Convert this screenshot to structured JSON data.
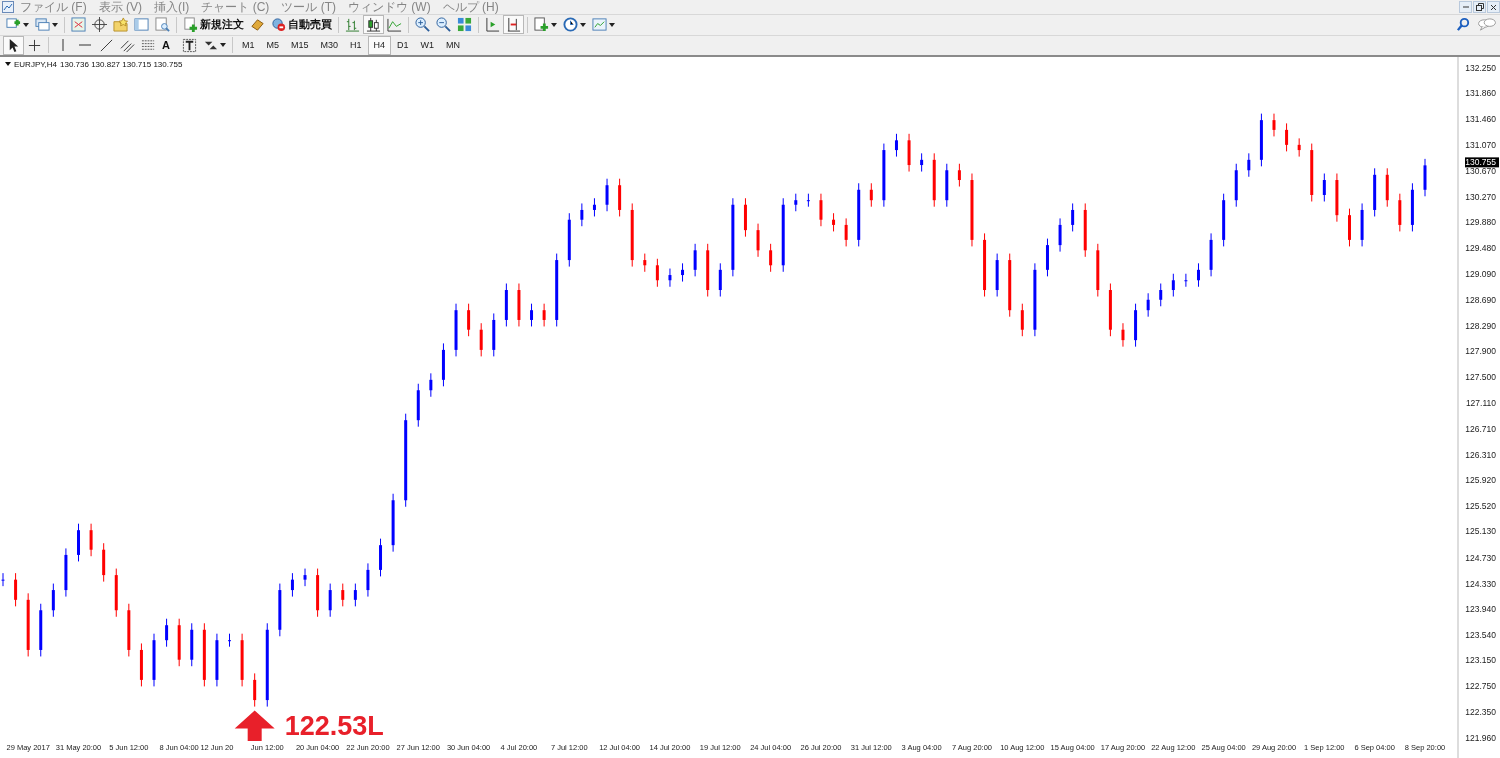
{
  "menu": [
    {
      "label": "ファイル (F)"
    },
    {
      "label": "表示 (V)"
    },
    {
      "label": "挿入(I)"
    },
    {
      "label": "チャート (C)"
    },
    {
      "label": "ツール (T)"
    },
    {
      "label": "ウィンドウ (W)"
    },
    {
      "label": "ヘルプ (H)"
    }
  ],
  "toolbar": {
    "order_button": "新規注文",
    "auto_trading_button": "自動売買",
    "text_tool": "A"
  },
  "timeframes": [
    {
      "label": "M1",
      "selected": false
    },
    {
      "label": "M5",
      "selected": false
    },
    {
      "label": "M15",
      "selected": false
    },
    {
      "label": "M30",
      "selected": false
    },
    {
      "label": "H1",
      "selected": false
    },
    {
      "label": "H4",
      "selected": true
    },
    {
      "label": "D1",
      "selected": false
    },
    {
      "label": "W1",
      "selected": false
    },
    {
      "label": "MN",
      "selected": false
    }
  ],
  "chart": {
    "symbol": "EURJPY,H4",
    "quote": "130.736 130.827 130.715 130.755",
    "price_tag": "130.755",
    "chart_data": {
      "type": "candlestick",
      "ylim": [
        121.65,
        132.42
      ],
      "categories": [
        null,
        null,
        "29 May 2017",
        null,
        null,
        null,
        "31 May 20:00",
        null,
        null,
        null,
        "5 Jun 12:00",
        null,
        null,
        null,
        "8 Jun 04:00",
        null,
        null,
        "12 Jun 20",
        null,
        null,
        null,
        "Jun 12:00",
        null,
        null,
        null,
        "20 Jun 04:00",
        null,
        null,
        null,
        "22 Jun 20:00",
        null,
        null,
        null,
        "27 Jun 12:00",
        null,
        null,
        null,
        "30 Jun 04:00",
        null,
        null,
        null,
        "4 Jul 20:00",
        null,
        null,
        null,
        "7 Jul 12:00",
        null,
        null,
        null,
        "12 Jul 04:00",
        null,
        null,
        null,
        "14 Jul 20:00",
        null,
        null,
        null,
        "19 Jul 12:00",
        null,
        null,
        null,
        "24 Jul 04:00",
        null,
        null,
        null,
        "26 Jul 20:00",
        null,
        null,
        null,
        "31 Jul 12:00",
        null,
        null,
        null,
        "3 Aug 04:00",
        null,
        null,
        null,
        "7 Aug 20:00",
        null,
        null,
        null,
        "10 Aug 12:00",
        null,
        null,
        null,
        "15 Aug 04:00",
        null,
        null,
        null,
        "17 Aug 20:00",
        null,
        null,
        null,
        "22 Aug 12:00",
        null,
        null,
        null,
        "25 Aug 04:00",
        null,
        null,
        null,
        "29 Aug 20:00",
        null,
        null,
        null,
        "1 Sep 12:00",
        null,
        null,
        null,
        "6 Sep 04:00",
        null,
        null,
        null,
        "8 Sep 20:00"
      ],
      "ohlc": [
        [
          124.39,
          124.49,
          124.29,
          124.39
        ],
        [
          124.39,
          124.49,
          123.98,
          124.08
        ],
        [
          124.08,
          124.18,
          123.21,
          123.31
        ],
        [
          123.31,
          124.02,
          123.21,
          123.92
        ],
        [
          123.92,
          124.33,
          123.82,
          124.23
        ],
        [
          124.23,
          124.87,
          124.13,
          124.77
        ],
        [
          124.77,
          125.25,
          124.67,
          125.15
        ],
        [
          125.15,
          125.25,
          124.75,
          124.85
        ],
        [
          124.85,
          124.95,
          124.36,
          124.46
        ],
        [
          124.46,
          124.56,
          123.82,
          123.92
        ],
        [
          123.92,
          124.02,
          123.21,
          123.31
        ],
        [
          123.31,
          123.41,
          122.75,
          122.85
        ],
        [
          122.85,
          123.56,
          122.75,
          123.46
        ],
        [
          123.46,
          123.79,
          123.36,
          123.69
        ],
        [
          123.69,
          123.79,
          123.06,
          123.16
        ],
        [
          123.16,
          123.72,
          123.06,
          123.62
        ],
        [
          123.62,
          123.72,
          122.75,
          122.85
        ],
        [
          122.85,
          123.56,
          122.75,
          123.46
        ],
        [
          123.46,
          123.56,
          123.36,
          123.46
        ],
        [
          123.46,
          123.56,
          122.75,
          122.85
        ],
        [
          122.85,
          122.95,
          122.44,
          122.54
        ],
        [
          122.54,
          123.72,
          122.44,
          123.62
        ],
        [
          123.62,
          124.33,
          123.52,
          124.23
        ],
        [
          124.23,
          124.49,
          124.13,
          124.39
        ],
        [
          124.39,
          124.56,
          124.29,
          124.46
        ],
        [
          124.46,
          124.56,
          123.82,
          123.92
        ],
        [
          123.92,
          124.33,
          123.82,
          124.23
        ],
        [
          124.23,
          124.33,
          123.98,
          124.08
        ],
        [
          124.08,
          124.33,
          123.98,
          124.23
        ],
        [
          124.23,
          124.64,
          124.13,
          124.54
        ],
        [
          124.54,
          125.02,
          124.44,
          124.92
        ],
        [
          124.92,
          125.71,
          124.82,
          125.61
        ],
        [
          125.61,
          126.94,
          125.51,
          126.84
        ],
        [
          126.84,
          127.4,
          126.74,
          127.3
        ],
        [
          127.3,
          127.56,
          127.2,
          127.46
        ],
        [
          127.46,
          128.02,
          127.36,
          127.92
        ],
        [
          127.92,
          128.63,
          127.82,
          128.53
        ],
        [
          128.53,
          128.63,
          128.13,
          128.23
        ],
        [
          128.23,
          128.33,
          127.82,
          127.92
        ],
        [
          127.92,
          128.48,
          127.82,
          128.38
        ],
        [
          128.38,
          128.94,
          128.28,
          128.84
        ],
        [
          128.84,
          128.94,
          128.28,
          128.38
        ],
        [
          128.38,
          128.63,
          128.28,
          128.53
        ],
        [
          128.53,
          128.63,
          128.28,
          128.38
        ],
        [
          128.38,
          129.4,
          128.28,
          129.3
        ],
        [
          129.3,
          130.02,
          129.2,
          129.92
        ],
        [
          129.92,
          130.17,
          129.82,
          130.07
        ],
        [
          130.07,
          130.25,
          129.97,
          130.15
        ],
        [
          130.15,
          130.55,
          130.05,
          130.45
        ],
        [
          130.45,
          130.55,
          129.97,
          130.07
        ],
        [
          130.07,
          130.17,
          129.2,
          129.3
        ],
        [
          129.3,
          129.4,
          129.12,
          129.22
        ],
        [
          129.22,
          129.32,
          128.89,
          128.99
        ],
        [
          128.99,
          129.17,
          128.89,
          129.07
        ],
        [
          129.07,
          129.25,
          128.97,
          129.15
        ],
        [
          129.15,
          129.55,
          129.05,
          129.45
        ],
        [
          129.45,
          129.55,
          128.74,
          128.84
        ],
        [
          128.84,
          129.25,
          128.74,
          129.15
        ],
        [
          129.15,
          130.25,
          129.05,
          130.15
        ],
        [
          130.15,
          130.25,
          129.66,
          129.76
        ],
        [
          129.76,
          129.86,
          129.35,
          129.45
        ],
        [
          129.45,
          129.55,
          129.12,
          129.22
        ],
        [
          129.22,
          130.25,
          129.12,
          130.15
        ],
        [
          130.15,
          130.32,
          130.05,
          130.22
        ],
        [
          130.22,
          130.32,
          130.12,
          130.22
        ],
        [
          130.22,
          130.32,
          129.82,
          129.92
        ],
        [
          129.92,
          130.02,
          129.74,
          129.84
        ],
        [
          129.84,
          129.94,
          129.51,
          129.61
        ],
        [
          129.61,
          130.48,
          129.51,
          130.38
        ],
        [
          130.38,
          130.48,
          130.12,
          130.22
        ],
        [
          130.22,
          131.09,
          130.12,
          130.99
        ],
        [
          130.99,
          131.24,
          130.89,
          131.14
        ],
        [
          131.14,
          131.24,
          130.66,
          130.76
        ],
        [
          130.76,
          130.94,
          130.66,
          130.84
        ],
        [
          130.84,
          130.94,
          130.12,
          130.22
        ],
        [
          130.22,
          130.78,
          130.12,
          130.68
        ],
        [
          130.68,
          130.78,
          130.43,
          130.53
        ],
        [
          130.53,
          130.63,
          129.51,
          129.61
        ],
        [
          129.61,
          129.71,
          128.74,
          128.84
        ],
        [
          128.84,
          129.4,
          128.74,
          129.3
        ],
        [
          129.3,
          129.4,
          128.43,
          128.53
        ],
        [
          128.53,
          128.63,
          128.13,
          128.23
        ],
        [
          128.23,
          129.25,
          128.13,
          129.15
        ],
        [
          129.15,
          129.63,
          129.05,
          129.53
        ],
        [
          129.53,
          129.94,
          129.43,
          129.84
        ],
        [
          129.84,
          130.17,
          129.74,
          130.07
        ],
        [
          130.07,
          130.17,
          129.35,
          129.45
        ],
        [
          129.45,
          129.55,
          128.74,
          128.84
        ],
        [
          128.84,
          128.94,
          128.13,
          128.23
        ],
        [
          128.23,
          128.33,
          127.97,
          128.07
        ],
        [
          128.07,
          128.63,
          127.97,
          128.53
        ],
        [
          128.53,
          128.79,
          128.43,
          128.69
        ],
        [
          128.69,
          128.94,
          128.59,
          128.84
        ],
        [
          128.84,
          129.09,
          128.74,
          128.99
        ],
        [
          128.99,
          129.09,
          128.89,
          128.99
        ],
        [
          128.99,
          129.25,
          128.89,
          129.15
        ],
        [
          129.15,
          129.71,
          129.05,
          129.61
        ],
        [
          129.61,
          130.32,
          129.51,
          130.22
        ],
        [
          130.22,
          130.78,
          130.12,
          130.68
        ],
        [
          130.68,
          130.94,
          130.58,
          130.84
        ],
        [
          130.84,
          131.55,
          130.74,
          131.45
        ],
        [
          131.45,
          131.55,
          131.2,
          131.3
        ],
        [
          131.3,
          131.4,
          130.97,
          131.07
        ],
        [
          131.07,
          131.17,
          130.89,
          130.99
        ],
        [
          130.99,
          131.09,
          130.2,
          130.3
        ],
        [
          130.3,
          130.63,
          130.2,
          130.53
        ],
        [
          130.53,
          130.63,
          129.89,
          129.99
        ],
        [
          129.99,
          130.09,
          129.51,
          129.61
        ],
        [
          129.61,
          130.17,
          129.51,
          130.07
        ],
        [
          130.07,
          130.71,
          129.97,
          130.61
        ],
        [
          130.61,
          130.71,
          130.12,
          130.22
        ],
        [
          130.22,
          130.32,
          129.74,
          129.84
        ],
        [
          129.84,
          130.48,
          129.74,
          130.38
        ],
        [
          130.38,
          130.855,
          130.28,
          130.755
        ]
      ],
      "yticks": [
        {
          "value": 132.25,
          "label": "132.250"
        },
        {
          "value": 131.86,
          "label": "131.860"
        },
        {
          "value": 131.46,
          "label": "131.460"
        },
        {
          "value": 131.07,
          "label": "131.070"
        },
        {
          "value": 130.67,
          "label": "130.670"
        },
        {
          "value": 130.27,
          "label": "130.270"
        },
        {
          "value": 129.88,
          "label": "129.880"
        },
        {
          "value": 129.48,
          "label": "129.480"
        },
        {
          "value": 129.09,
          "label": "129.090"
        },
        {
          "value": 128.69,
          "label": "128.690"
        },
        {
          "value": 128.29,
          "label": "128.290"
        },
        {
          "value": 127.9,
          "label": "127.900"
        },
        {
          "value": 127.5,
          "label": "127.500"
        },
        {
          "value": 127.11,
          "label": "127.110"
        },
        {
          "value": 126.71,
          "label": "126.710"
        },
        {
          "value": 126.31,
          "label": "126.310"
        },
        {
          "value": 125.92,
          "label": "125.920"
        },
        {
          "value": 125.52,
          "label": "125.520"
        },
        {
          "value": 125.13,
          "label": "125.130"
        },
        {
          "value": 124.73,
          "label": "124.730"
        },
        {
          "value": 124.33,
          "label": "124.330"
        },
        {
          "value": 123.94,
          "label": "123.940"
        },
        {
          "value": 123.54,
          "label": "123.540"
        },
        {
          "value": 123.15,
          "label": "123.150"
        },
        {
          "value": 122.75,
          "label": "122.750"
        },
        {
          "value": 122.35,
          "label": "122.350"
        },
        {
          "value": 121.96,
          "label": "121.960"
        }
      ],
      "annotations": [
        "122.53L"
      ]
    }
  }
}
